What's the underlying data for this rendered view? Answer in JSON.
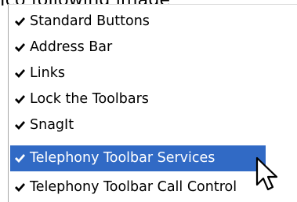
{
  "header": {
    "partial_text": "Ico following image"
  },
  "menu": {
    "items": [
      {
        "label": "Standard Buttons",
        "checked": true
      },
      {
        "label": "Address Bar",
        "checked": true
      },
      {
        "label": "Links",
        "checked": true
      },
      {
        "label": "Lock the Toolbars",
        "checked": true
      },
      {
        "label": "SnagIt",
        "checked": true
      },
      {
        "label": "Telephony Toolbar Services",
        "checked": true,
        "highlighted": true
      },
      {
        "label": "Telephony Toolbar Call Control",
        "checked": true
      }
    ]
  },
  "colors": {
    "highlight": "#316ac5",
    "highlight_text": "#ffffff",
    "text": "#000000"
  },
  "icons": {
    "check": "check-icon",
    "cursor": "arrow-cursor-icon"
  }
}
